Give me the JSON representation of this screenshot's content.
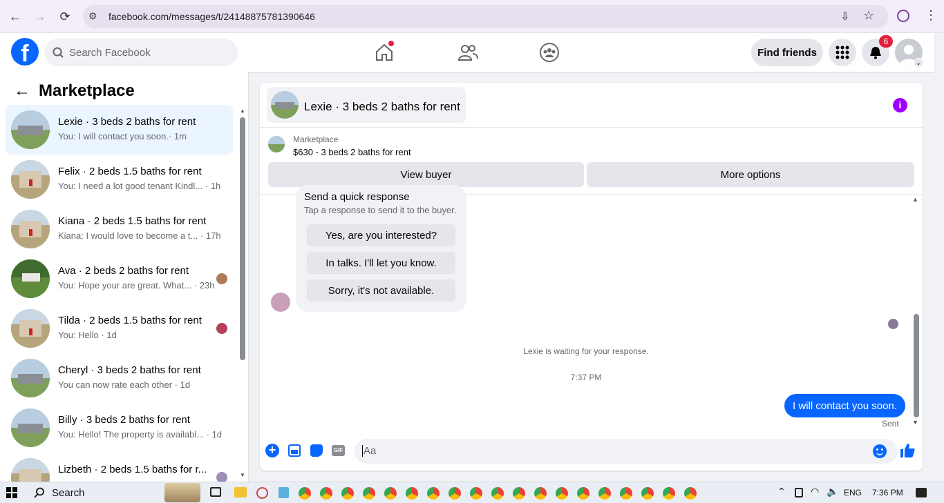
{
  "browser": {
    "url": "facebook.com/messages/t/24148875781390646"
  },
  "header": {
    "search_placeholder": "Search Facebook",
    "find_friends": "Find friends",
    "notif_count": "6"
  },
  "sidebar": {
    "title": "Marketplace",
    "conversations": [
      {
        "title": "Lexie · 3 beds 2 baths for rent",
        "snippet": "You: I will contact you soon.",
        "time": "· 1m"
      },
      {
        "title": "Felix · 2 beds 1.5 baths for rent",
        "snippet": "You: I need a lot good tenant Kindl...",
        "time": "· 1h"
      },
      {
        "title": "Kiana · 2 beds 1.5 baths for rent",
        "snippet": "Kiana: I would love to become a t...",
        "time": "· 17h"
      },
      {
        "title": "Ava · 2 beds 2 baths for rent",
        "snippet": "You: Hope your are great. What...",
        "time": "· 23h"
      },
      {
        "title": "Tilda · 2 beds 1.5 baths for rent",
        "snippet": "You: Hello",
        "time": "· 1d"
      },
      {
        "title": "Cheryl · 3 beds 2 baths for rent",
        "snippet": "You can now rate each other",
        "time": "· 1d"
      },
      {
        "title": "Billy · 3 beds 2 baths for rent",
        "snippet": "You: Hello! The property is availabl...",
        "time": "· 1d"
      },
      {
        "title": "Lizbeth · 2 beds 1.5 baths for r...",
        "snippet": "",
        "time": ""
      }
    ]
  },
  "chat": {
    "title": "Lexie · 3 beds 2 baths for rent",
    "mp_label": "Marketplace",
    "mp_price": "$630 - 3 beds 2 baths for rent",
    "view_buyer": "View buyer",
    "more_options": "More options",
    "quick": {
      "title": "Send a quick response",
      "subtitle": "Tap a response to send it to the buyer.",
      "r1": "Yes, are you interested?",
      "r2": "In talks. I'll let you know.",
      "r3": "Sorry, it's not available."
    },
    "waiting": "Lexie is waiting for your response.",
    "time": "7:37 PM",
    "message": "I will contact you soon.",
    "sent": "Sent",
    "composer_placeholder": "Aa"
  },
  "taskbar": {
    "search": "Search",
    "lang": "ENG",
    "clock": "7:36 PM"
  }
}
